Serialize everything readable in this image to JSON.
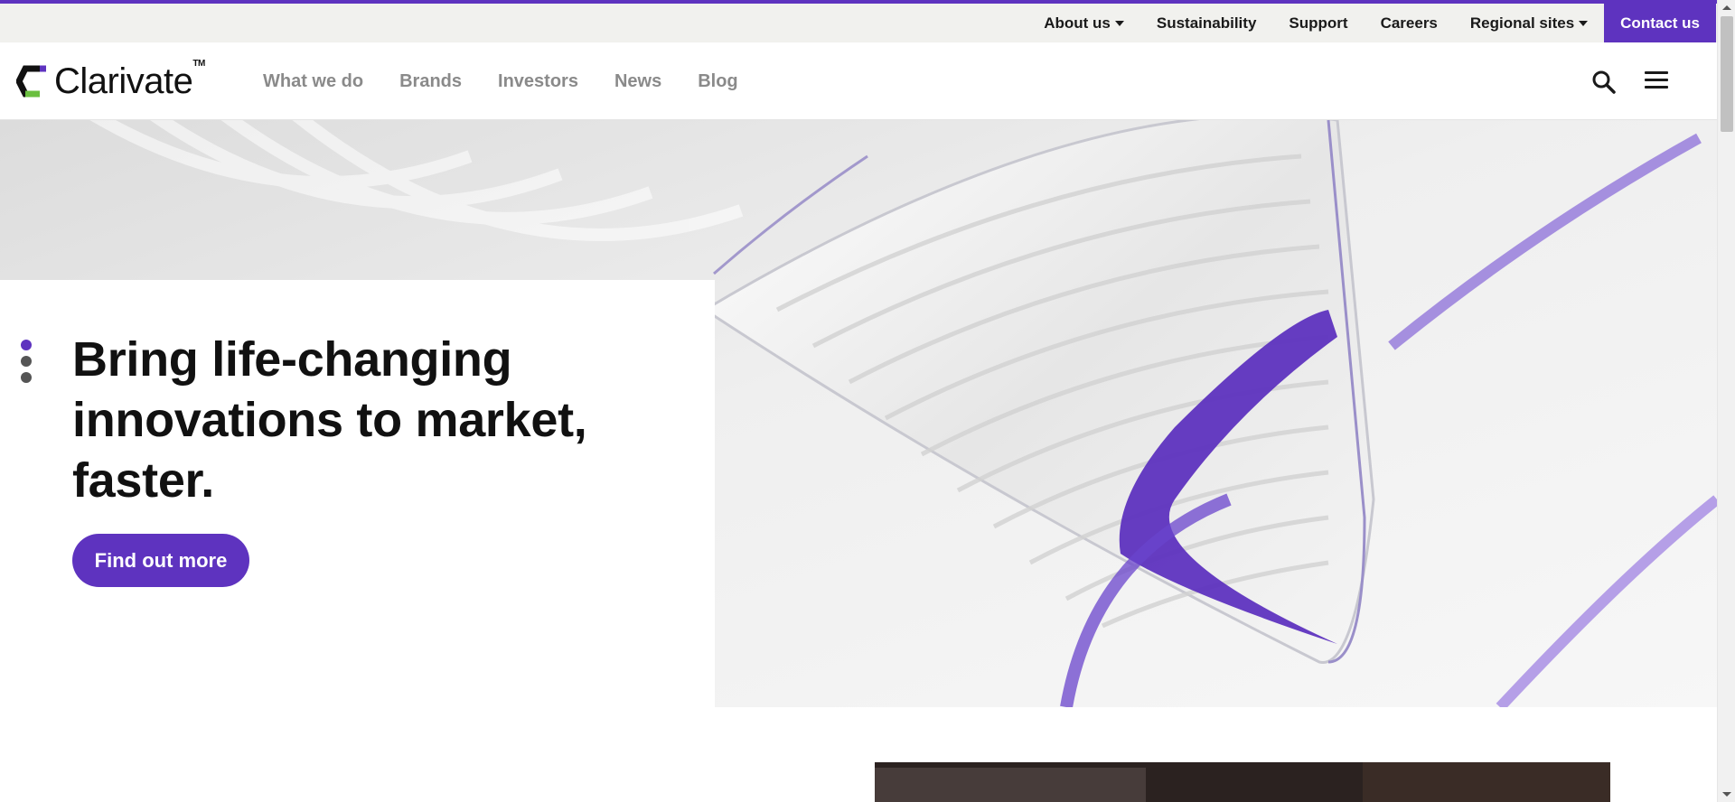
{
  "colors": {
    "brand_purple": "#5e33bf",
    "utility_bar_bg": "#f1f1ee",
    "nav_text": "#8a8a8a",
    "text_dark": "#111111",
    "logo_green": "#6abf3f"
  },
  "utility_nav": {
    "items": [
      {
        "label": "About us",
        "has_dropdown": true
      },
      {
        "label": "Sustainability",
        "has_dropdown": false
      },
      {
        "label": "Support",
        "has_dropdown": false
      },
      {
        "label": "Careers",
        "has_dropdown": false
      },
      {
        "label": "Regional sites",
        "has_dropdown": true
      }
    ],
    "contact_label": "Contact us"
  },
  "header": {
    "logo_text": "Clarivate",
    "logo_tm": "TM",
    "nav_items": [
      "What we do",
      "Brands",
      "Investors",
      "News",
      "Blog"
    ],
    "icons": [
      "search-icon",
      "hamburger-menu-icon"
    ]
  },
  "hero": {
    "headline": "Bring life-changing innovations to market, faster.",
    "cta_label": "Find out more",
    "carousel": {
      "total_slides": 3,
      "active_slide": 1
    }
  }
}
